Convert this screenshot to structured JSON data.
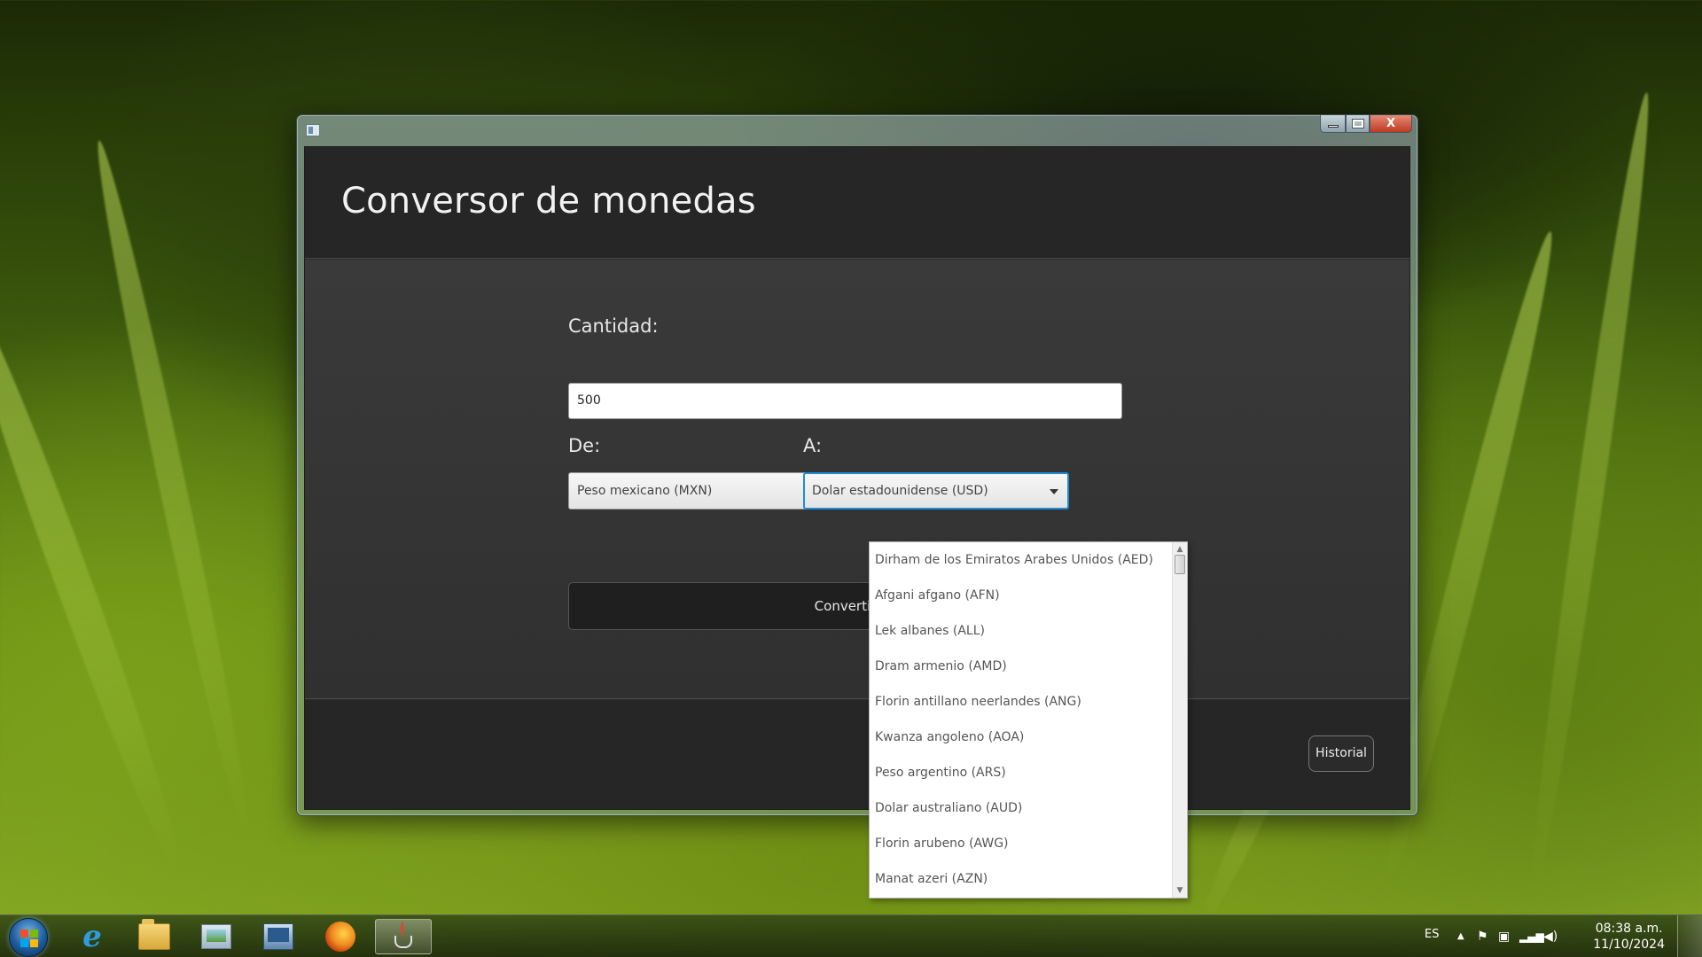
{
  "window": {
    "title": "Conversor de monedas",
    "controls": {
      "minimize": "minimize",
      "maximize": "maximize",
      "close": "X"
    }
  },
  "form": {
    "amount_label": "Cantidad:",
    "amount_value": "500",
    "from_label": "De:",
    "to_label": "A:",
    "from_currency": "Peso mexicano (MXN)",
    "to_currency": "Dolar estadounidense (USD)",
    "convert_button": "Convertir"
  },
  "dropdown": {
    "options": [
      "Dirham de los Emiratos Arabes Unidos (AED)",
      "Afgani afgano (AFN)",
      "Lek albanes (ALL)",
      "Dram armenio (AMD)",
      "Florin antillano neerlandes (ANG)",
      "Kwanza angoleno (AOA)",
      "Peso argentino (ARS)",
      "Dolar australiano (AUD)",
      "Florin arubeno (AWG)",
      "Manat azeri (AZN)"
    ]
  },
  "footer": {
    "history_button": "Historial"
  },
  "taskbar": {
    "language": "ES",
    "time": "08:38 a.m.",
    "date": "11/10/2024",
    "apps": [
      "internet-explorer",
      "windows-explorer",
      "photo-viewer",
      "computer",
      "firefox",
      "java"
    ]
  },
  "colors": {
    "accent": "#1f8bd6",
    "app_background": "#2b2b2b",
    "header_background": "#262626"
  }
}
